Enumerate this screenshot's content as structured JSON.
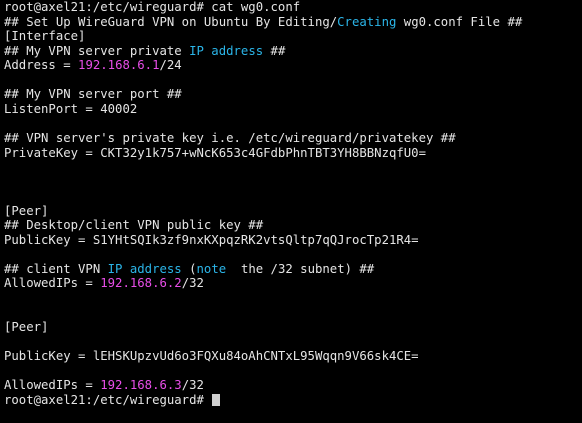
{
  "colors": {
    "background": "#000000",
    "text": "#e5e5e5",
    "keyword_cyan": "#2bb5e8",
    "ip_magenta": "#e84ee8",
    "cursor": "#d0d0d0"
  },
  "terminal": {
    "lines": [
      [
        {
          "text": "root@axel21:/etc/wireguard# cat wg0.conf",
          "color": "text"
        }
      ],
      [
        {
          "text": "## Set Up WireGuard VPN on Ubuntu By Editing/",
          "color": "text"
        },
        {
          "text": "Creating",
          "color": "keyword_cyan"
        },
        {
          "text": " wg0.conf File ##",
          "color": "text"
        }
      ],
      [
        {
          "text": "[Interface]",
          "color": "text"
        }
      ],
      [
        {
          "text": "## My VPN server private ",
          "color": "text"
        },
        {
          "text": "IP address",
          "color": "keyword_cyan"
        },
        {
          "text": " ##",
          "color": "text"
        }
      ],
      [
        {
          "text": "Address = ",
          "color": "text"
        },
        {
          "text": "192.168.6.1",
          "color": "ip_magenta"
        },
        {
          "text": "/24",
          "color": "text"
        }
      ],
      [],
      [
        {
          "text": "## My VPN server port ##",
          "color": "text"
        }
      ],
      [
        {
          "text": "ListenPort = 40002",
          "color": "text"
        }
      ],
      [],
      [
        {
          "text": "## VPN server's private key i.e. /etc/wireguard/privatekey ##",
          "color": "text"
        }
      ],
      [
        {
          "text": "PrivateKey = CKT32y1k757+wNcK653c4GFdbPhnTBT3YH8BBNzqfU0=",
          "color": "text"
        }
      ],
      [],
      [],
      [],
      [
        {
          "text": "[Peer]",
          "color": "text"
        }
      ],
      [
        {
          "text": "## Desktop/client VPN public key ##",
          "color": "text"
        }
      ],
      [
        {
          "text": "PublicKey = S1YHtSQIk3zf9nxKXpqzRK2vtsQltp7qQJrocTp21R4=",
          "color": "text"
        }
      ],
      [],
      [
        {
          "text": "## client VPN ",
          "color": "text"
        },
        {
          "text": "IP address",
          "color": "keyword_cyan"
        },
        {
          "text": " (",
          "color": "text"
        },
        {
          "text": "note",
          "color": "keyword_cyan"
        },
        {
          "text": "  the /32 subnet) ##",
          "color": "text"
        }
      ],
      [
        {
          "text": "AllowedIPs = ",
          "color": "text"
        },
        {
          "text": "192.168.6.2",
          "color": "ip_magenta"
        },
        {
          "text": "/32",
          "color": "text"
        }
      ],
      [],
      [],
      [
        {
          "text": "[Peer]",
          "color": "text"
        }
      ],
      [],
      [
        {
          "text": "PublicKey = lEHSKUpzvUd6o3FQXu84oAhCNTxL95Wqqn9V66sk4CE=",
          "color": "text"
        }
      ],
      [],
      [
        {
          "text": "AllowedIPs = ",
          "color": "text"
        },
        {
          "text": "192.168.6.3",
          "color": "ip_magenta"
        },
        {
          "text": "/32",
          "color": "text"
        }
      ],
      [
        {
          "text": "root@axel21:/etc/wireguard# ",
          "color": "text"
        }
      ]
    ]
  }
}
